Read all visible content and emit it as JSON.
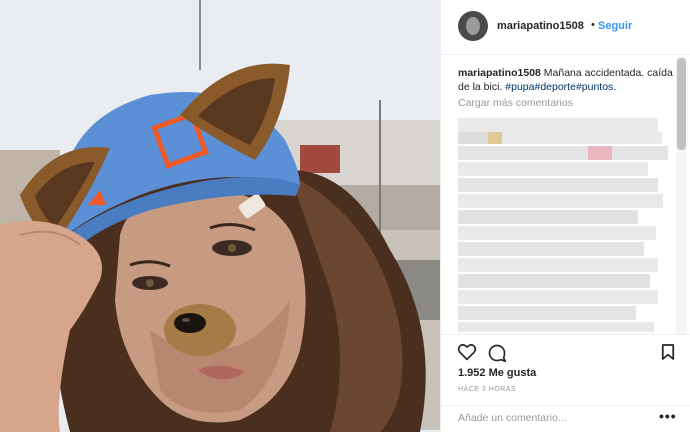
{
  "post": {
    "username": "mariapatino1508",
    "separator": "•",
    "follow_label": "Seguir",
    "caption": {
      "username": "mariapatino1508",
      "text": " Mañana accidentada. caída de la bici. ",
      "tags": [
        "#pupa",
        "#deporte",
        "#puntos."
      ]
    },
    "load_more_label": "Cargar más comentarios",
    "likes": "1.952 Me gusta",
    "time": "HACE 3 HORAS",
    "comment_placeholder": "Añade un comentario...",
    "options_label": "•••"
  },
  "icons": {
    "like": "heart-icon",
    "comment": "comment-icon",
    "save": "bookmark-icon",
    "options": "more-options-icon"
  },
  "colors": {
    "link": "#3897f0",
    "hashtag": "#003569",
    "muted": "#999999",
    "cap": "#5b8fd6",
    "cap_logo": "#f05a28",
    "ear_fur": "#8a5a2b"
  }
}
